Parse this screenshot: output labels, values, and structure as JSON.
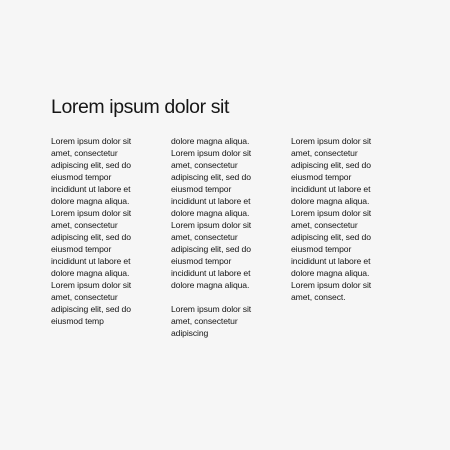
{
  "document": {
    "title": "Lorem ipsum dolor sit",
    "columns": [
      {
        "lines": [
          "Lorem ipsum dolor sit",
          "amet, consectetur",
          "adipiscing elit, sed do",
          "eiusmod tempor",
          "incididunt ut labore et",
          "dolore magna aliqua.",
          "Lorem ipsum dolor sit",
          "amet, consectetur",
          "adipiscing elit, sed do",
          "eiusmod tempor",
          "incididunt ut labore et",
          "dolore magna aliqua.",
          "Lorem ipsum dolor sit",
          "amet, consectetur",
          "adipiscing elit, sed do",
          "eiusmod temp"
        ]
      },
      {
        "lines": [
          "dolore magna aliqua.",
          "Lorem ipsum dolor sit",
          "amet, consectetur",
          "adipiscing elit, sed do",
          "eiusmod tempor",
          "incididunt ut labore et",
          "dolore magna aliqua.",
          "Lorem ipsum dolor sit",
          "amet, consectetur",
          "adipiscing elit, sed do",
          "eiusmod tempor",
          "incididunt ut labore et",
          "dolore magna aliqua.",
          "",
          "Lorem ipsum dolor sit",
          "amet, consectetur",
          "adipiscing"
        ]
      },
      {
        "lines": [
          "Lorem ipsum dolor sit",
          "amet, consectetur",
          "adipiscing elit, sed do",
          "eiusmod tempor",
          "incididunt ut labore et",
          "dolore magna aliqua.",
          "Lorem ipsum dolor sit",
          "amet, consectetur",
          "adipiscing elit, sed do",
          "eiusmod tempor",
          "incididunt ut labore et",
          "dolore magna aliqua.",
          "Lorem ipsum dolor sit",
          "amet, consect."
        ]
      }
    ]
  }
}
